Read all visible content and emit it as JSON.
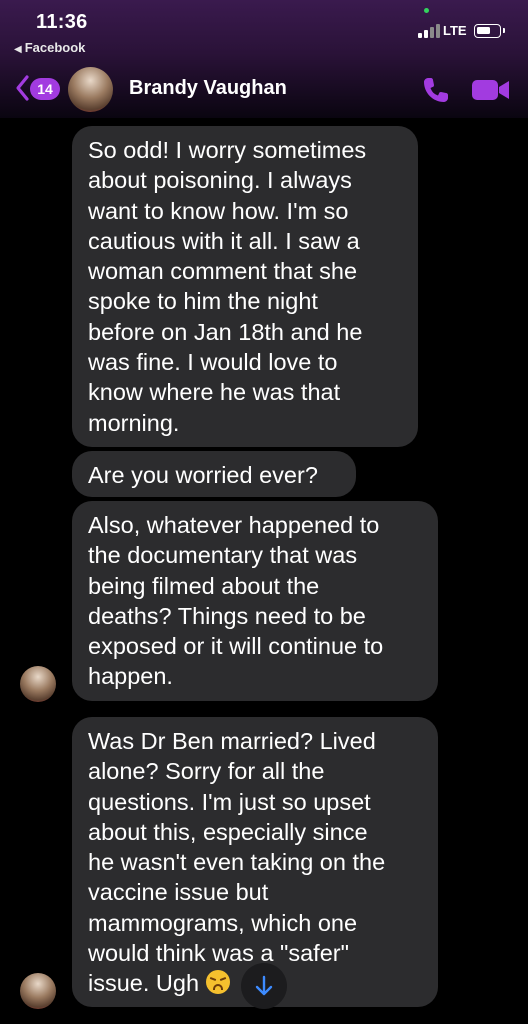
{
  "status_bar": {
    "time": "11:36",
    "back_app": "Facebook",
    "network": "LTE",
    "icons": [
      "signal-icon",
      "battery-icon"
    ]
  },
  "header": {
    "unread_count": "14",
    "contact_name": "Brandy Vaughan",
    "icons": [
      "back-chevron-icon",
      "phone-icon",
      "video-camera-icon"
    ],
    "accent_color": "#a23be0"
  },
  "messages": [
    {
      "sender": "contact",
      "lines": [
        "So odd! I worry sometimes",
        "about poisoning. I always",
        "want to know how. I'm so",
        "cautious with it all. I saw a",
        "woman comment that she",
        "spoke to him the night",
        "before on Jan 18th and he",
        "was fine. I would love to",
        "know where he was that",
        "morning."
      ]
    },
    {
      "sender": "contact",
      "lines": [
        "Are you worried ever?"
      ]
    },
    {
      "sender": "contact",
      "lines": [
        "Also, whatever happened to",
        "the documentary that was",
        "being filmed about the",
        "deaths? Things need to be",
        "exposed or it will continue to",
        "happen."
      ]
    },
    {
      "sender": "contact",
      "lines": [
        "Was Dr Ben married? Lived",
        "alone? Sorry for all the",
        "questions. I'm just so upset",
        "about this, especially since",
        "he wasn't even taking on the",
        "vaccine issue but",
        "mammograms, which one",
        "would think was a \"safer\"",
        "issue. Ugh"
      ],
      "trailing_emoji": "weary-face-emoji"
    }
  ],
  "colors": {
    "bubble_bg": "#2c2c2e",
    "background": "#000000"
  }
}
